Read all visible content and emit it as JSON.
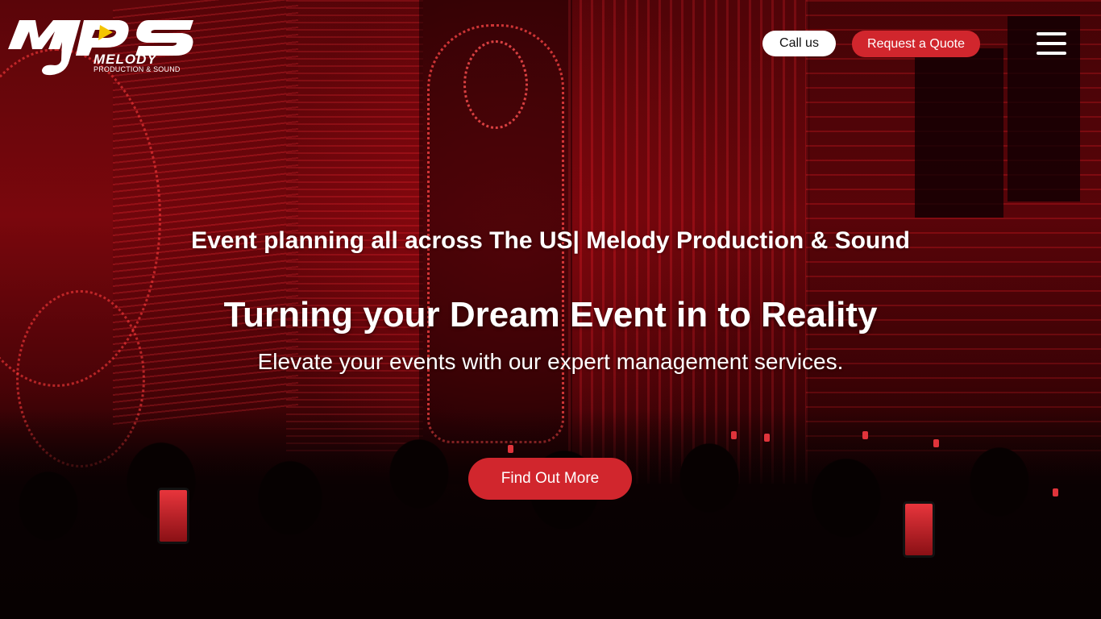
{
  "header": {
    "logo": {
      "letters": "MPS",
      "wordmark": "MELODY",
      "subline": "PRODUCTION & SOUND",
      "accent_color": "#f4c400"
    },
    "call_label": "Call us",
    "quote_label": "Request a Quote",
    "menu_icon": "hamburger-menu-icon"
  },
  "hero": {
    "subtitle": "Event planning all across The US| Melody Production & Sound",
    "title": "Turning your Dream Event in to Reality",
    "tagline": "Elevate your events with our expert management services.",
    "cta_label": "Find Out More"
  },
  "colors": {
    "brand_red": "#d1262d",
    "white": "#ffffff",
    "background_dark": "#0d0203"
  }
}
